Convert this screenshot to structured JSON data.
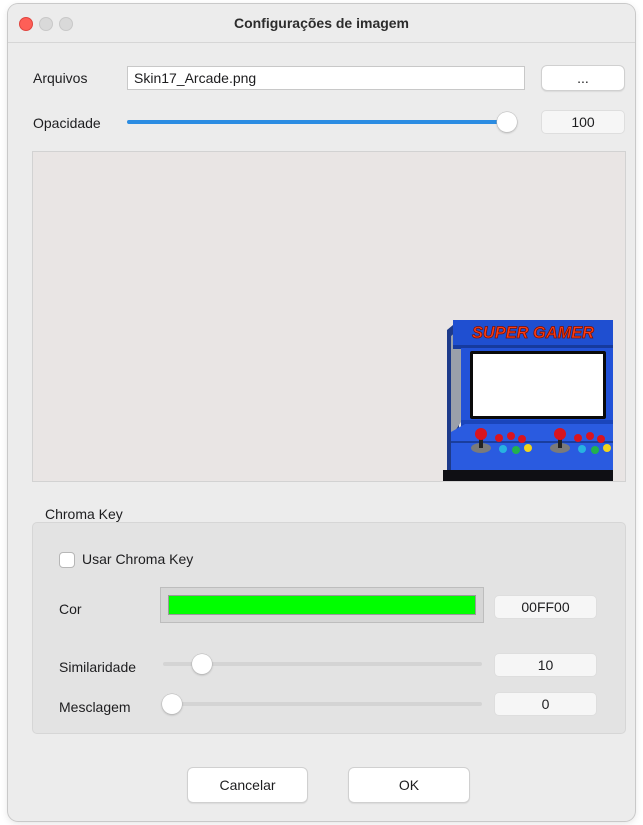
{
  "window": {
    "title": "Configurações de imagem"
  },
  "files": {
    "label": "Arquivos",
    "value": "Skin17_Arcade.png",
    "browse_label": "..."
  },
  "opacity": {
    "label": "Opacidade",
    "value": "100",
    "slider_level": 1.0
  },
  "preview": {
    "image": "arcade-cabinet-skin",
    "logo_text": "SUPER GAMER"
  },
  "chroma": {
    "group_label": "Chroma Key",
    "use_label": "Usar Chroma Key",
    "use_checked": false,
    "color_label": "Cor",
    "color_value": "00FF00",
    "color_hex": "#00ff00",
    "similarity_label": "Similaridade",
    "similarity_value": "10",
    "blend_label": "Mesclagem",
    "blend_value": "0"
  },
  "actions": {
    "cancel_label": "Cancelar",
    "ok_label": "OK"
  },
  "colors": {
    "accent": "#2b8ce2",
    "close": "#fe5f57"
  }
}
